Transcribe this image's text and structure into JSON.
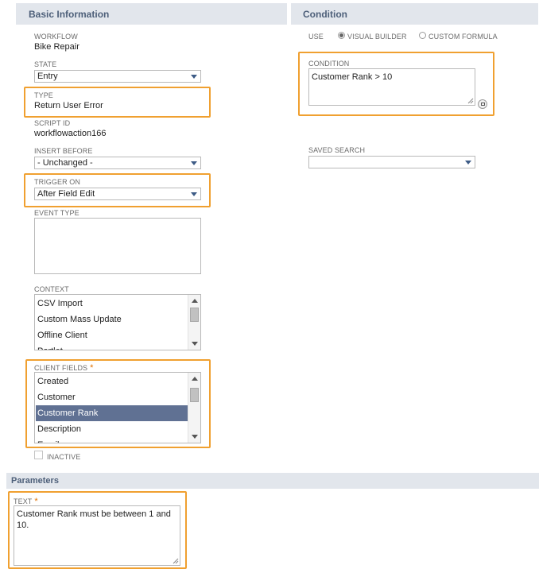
{
  "sections": {
    "basic_information": "Basic Information",
    "condition": "Condition",
    "parameters": "Parameters"
  },
  "workflow": {
    "label": "WORKFLOW",
    "value": "Bike Repair"
  },
  "state": {
    "label": "STATE",
    "value": "Entry"
  },
  "type": {
    "label": "TYPE",
    "value": "Return User Error"
  },
  "script_id": {
    "label": "SCRIPT ID",
    "value": "workflowaction166"
  },
  "insert_before": {
    "label": "INSERT BEFORE",
    "value": "- Unchanged -"
  },
  "trigger_on": {
    "label": "TRIGGER ON",
    "value": "After Field Edit"
  },
  "event_type": {
    "label": "EVENT TYPE",
    "value": ""
  },
  "context": {
    "label": "CONTEXT",
    "options": [
      "CSV Import",
      "Custom Mass Update",
      "Offline Client",
      "Portlet"
    ]
  },
  "client_fields": {
    "label": "CLIENT FIELDS",
    "required_mark": "*",
    "options": [
      "Created",
      "Customer",
      "Customer Rank",
      "Description",
      "Email"
    ],
    "selected": "Customer Rank"
  },
  "inactive": {
    "label": "INACTIVE",
    "checked": false
  },
  "use": {
    "label": "USE",
    "options": [
      "VISUAL BUILDER",
      "CUSTOM FORMULA"
    ],
    "selected": "VISUAL BUILDER"
  },
  "condition_field": {
    "label": "CONDITION",
    "value": "Customer Rank > 10"
  },
  "saved_search": {
    "label": "SAVED SEARCH",
    "value": ""
  },
  "text_param": {
    "label": "TEXT",
    "required_mark": "*",
    "value": "Customer Rank must be between 1 and 10."
  },
  "colors": {
    "section_header_bg": "#e2e6ec",
    "section_header_text": "#4d5f79",
    "highlight": "#f0a030",
    "selected_row": "#607193",
    "dropdown_arrow": "#3d5b86"
  }
}
